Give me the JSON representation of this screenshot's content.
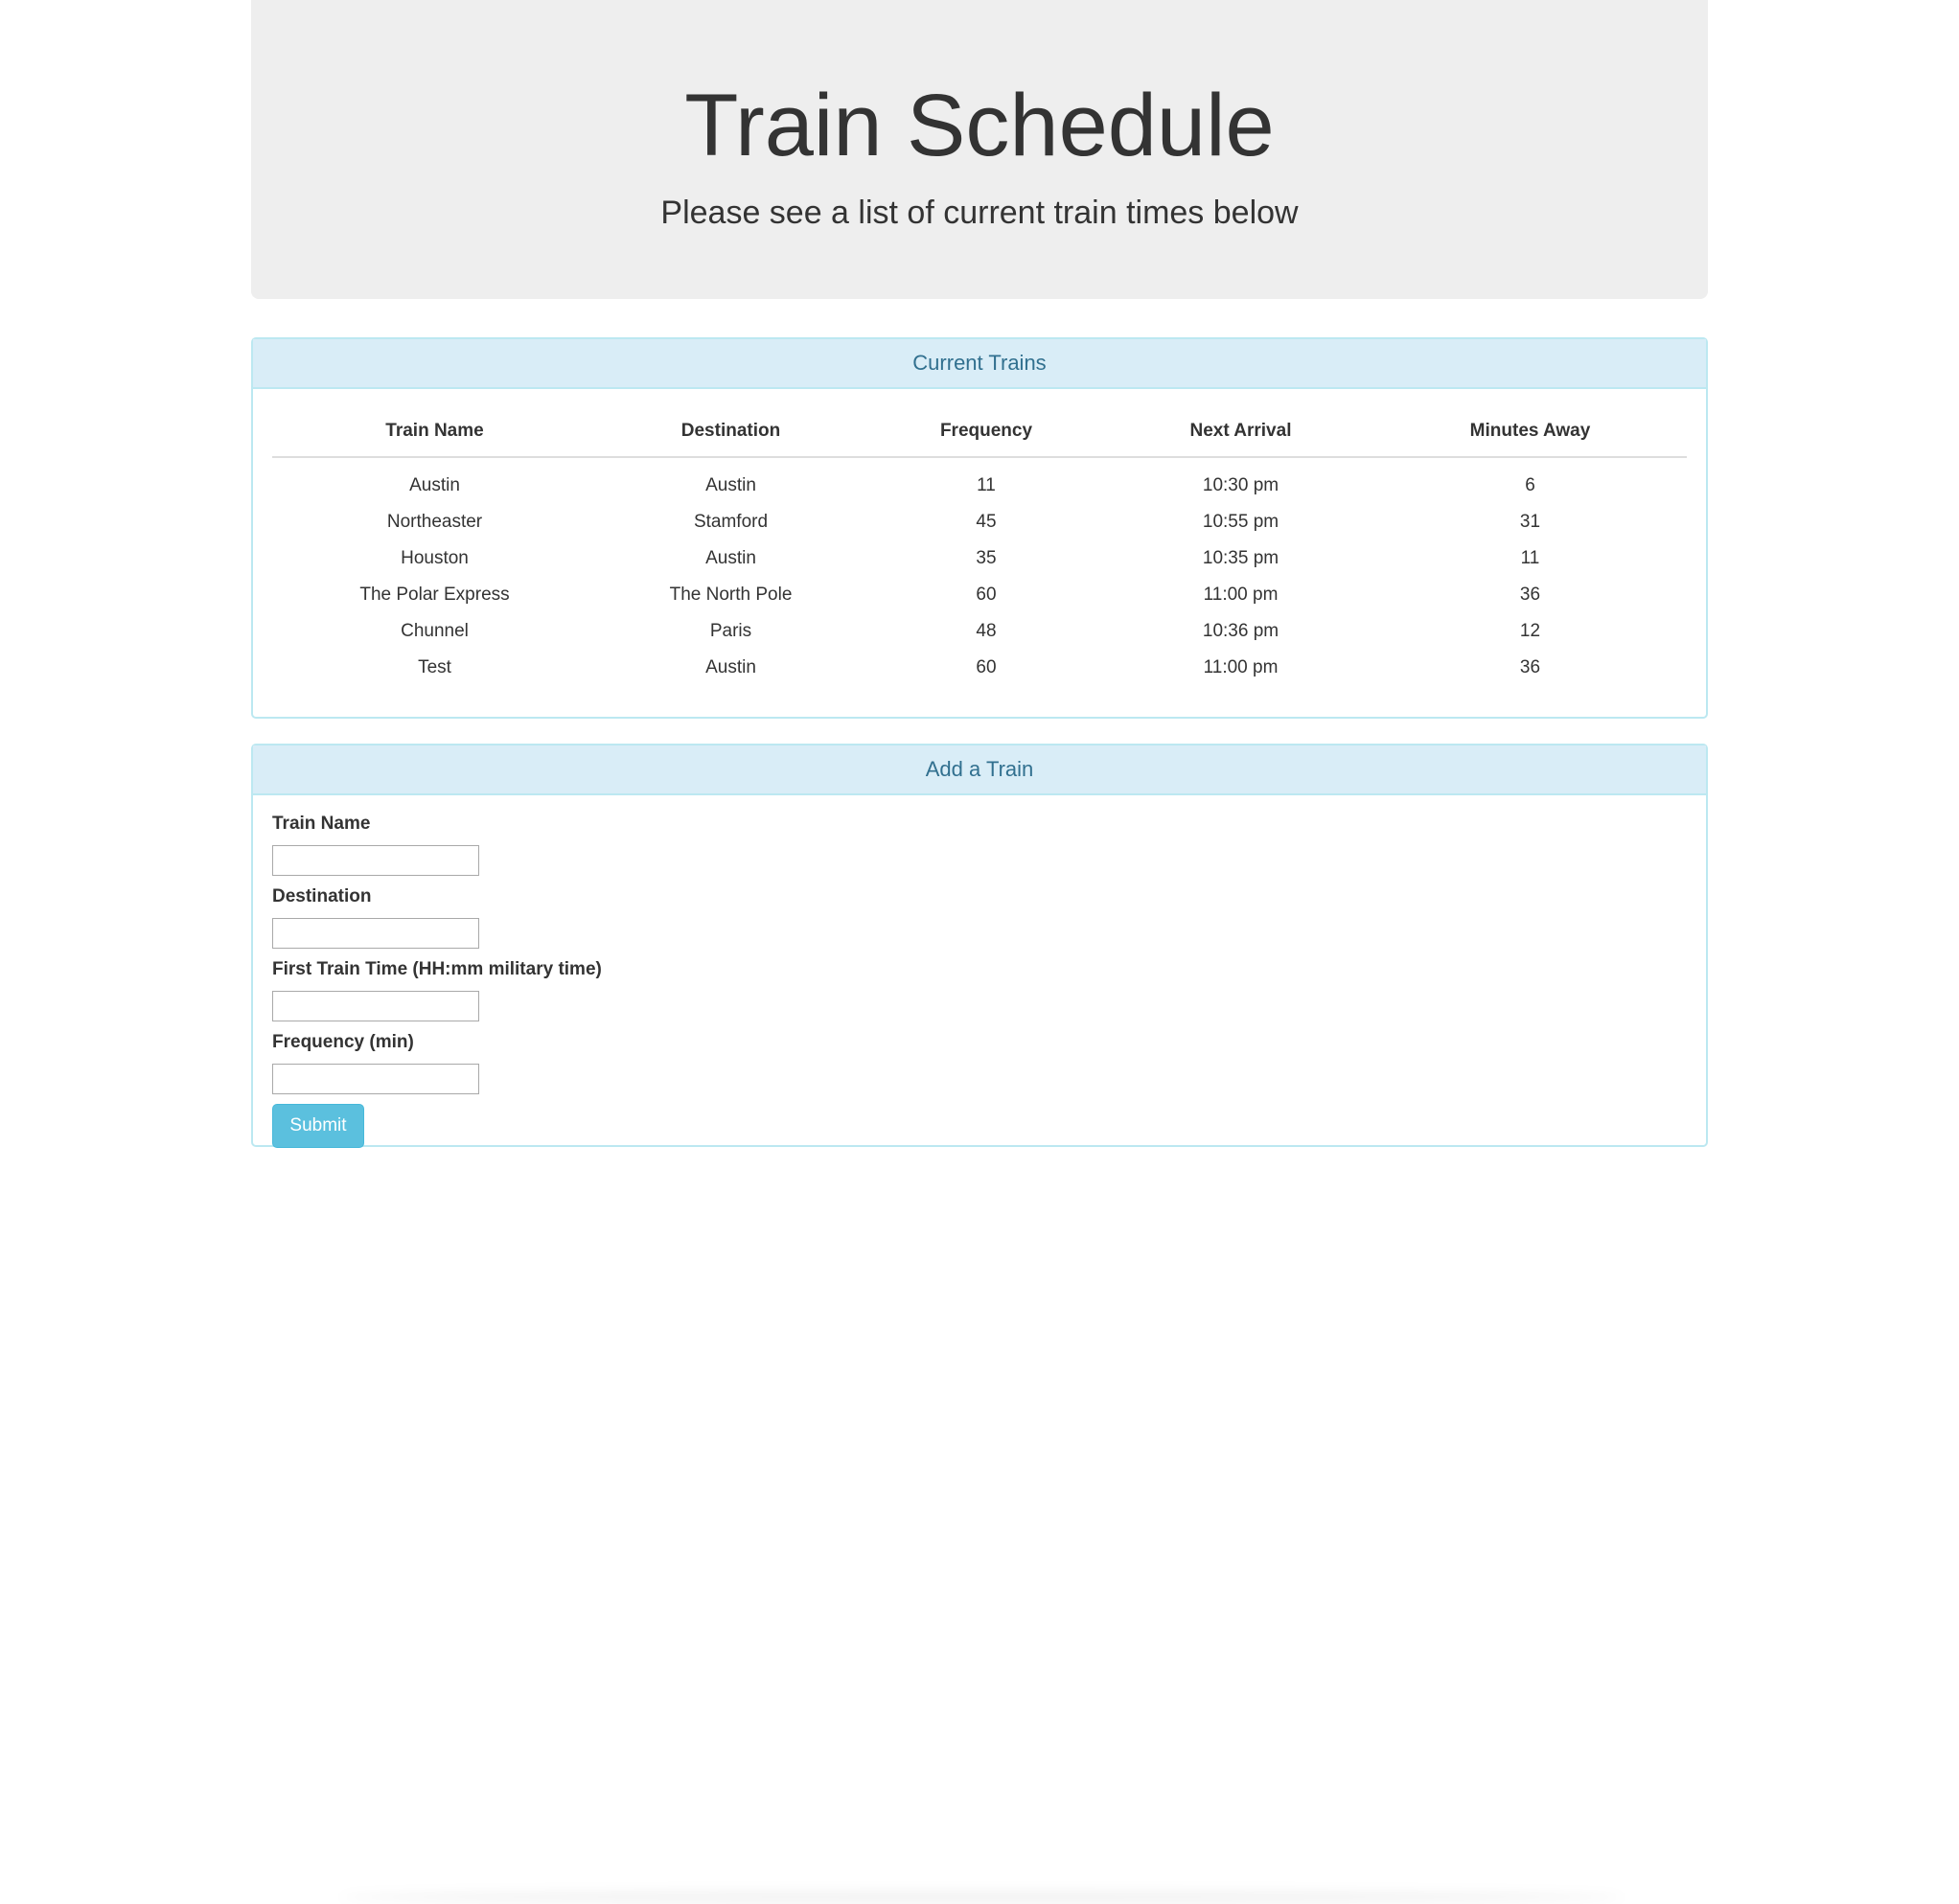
{
  "header": {
    "title": "Train Schedule",
    "subtitle": "Please see a list of current train times below"
  },
  "current_trains": {
    "heading": "Current Trains",
    "columns": [
      "Train Name",
      "Destination",
      "Frequency",
      "Next Arrival",
      "Minutes Away"
    ],
    "rows": [
      [
        "Austin",
        "Austin",
        "11",
        "10:30 pm",
        "6"
      ],
      [
        "Northeaster",
        "Stamford",
        "45",
        "10:55 pm",
        "31"
      ],
      [
        "Houston",
        "Austin",
        "35",
        "10:35 pm",
        "11"
      ],
      [
        "The Polar Express",
        "The North Pole",
        "60",
        "11:00 pm",
        "36"
      ],
      [
        "Chunnel",
        "Paris",
        "48",
        "10:36 pm",
        "12"
      ],
      [
        "Test",
        "Austin",
        "60",
        "11:00 pm",
        "36"
      ]
    ]
  },
  "add_train": {
    "heading": "Add a Train",
    "fields": [
      {
        "label": "Train Name",
        "value": ""
      },
      {
        "label": "Destination",
        "value": ""
      },
      {
        "label": "First Train Time (HH:mm military time)",
        "value": ""
      },
      {
        "label": "Frequency (min)",
        "value": ""
      }
    ],
    "submit_label": "Submit"
  },
  "colors": {
    "jumbotron_bg": "#eeeeee",
    "panel_heading_bg": "#d9edf7",
    "panel_heading_text": "#31708f",
    "panel_border": "#bce8f1",
    "button_bg": "#5bc0de"
  }
}
